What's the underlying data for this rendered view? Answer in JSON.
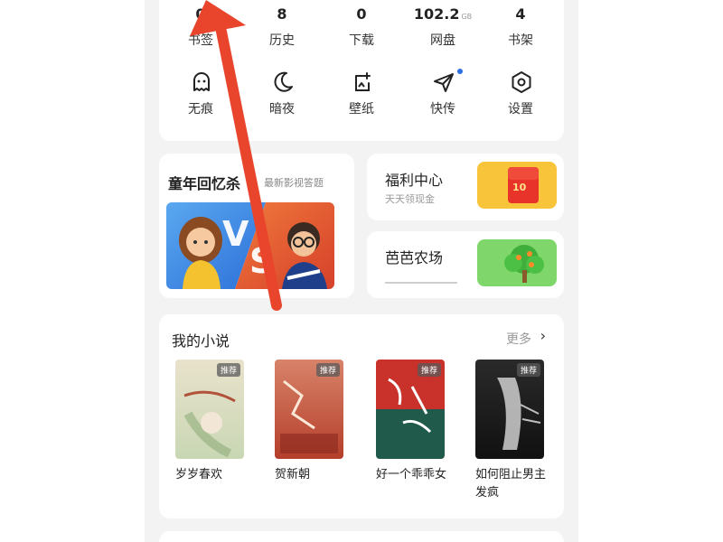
{
  "stats": [
    {
      "value": "0",
      "unit": "",
      "label": "书签"
    },
    {
      "value": "8",
      "unit": "",
      "label": "历史"
    },
    {
      "value": "0",
      "unit": "",
      "label": "下载"
    },
    {
      "value": "102.2",
      "unit": "GB",
      "label": "网盘"
    },
    {
      "value": "4",
      "unit": "",
      "label": "书架"
    }
  ],
  "tools": [
    {
      "icon": "ghost-icon",
      "label": "无痕"
    },
    {
      "icon": "moon-icon",
      "label": "暗夜"
    },
    {
      "icon": "wallpaper-icon",
      "label": "壁纸"
    },
    {
      "icon": "send-icon",
      "label": "快传"
    },
    {
      "icon": "settings-icon",
      "label": "设置"
    }
  ],
  "promo": {
    "title": "童年回忆杀",
    "subtitle": "最新影视答题"
  },
  "welfare": {
    "title": "福利中心",
    "subtitle": "天天领现金"
  },
  "farm": {
    "title": "芭芭农场",
    "subtitle": ""
  },
  "novels": {
    "heading": "我的小说",
    "more": "更多",
    "tag": "推荐",
    "books": [
      {
        "title": "岁岁春欢"
      },
      {
        "title": "贺新朝"
      },
      {
        "title": "好一个乖乖女"
      },
      {
        "title": "如何阻止男主发疯"
      }
    ]
  },
  "colors": {
    "arrow": "#e8452c",
    "accent": "#2b6fe0",
    "vs_blue": "#3b7fe0",
    "vs_red": "#e8552c"
  }
}
